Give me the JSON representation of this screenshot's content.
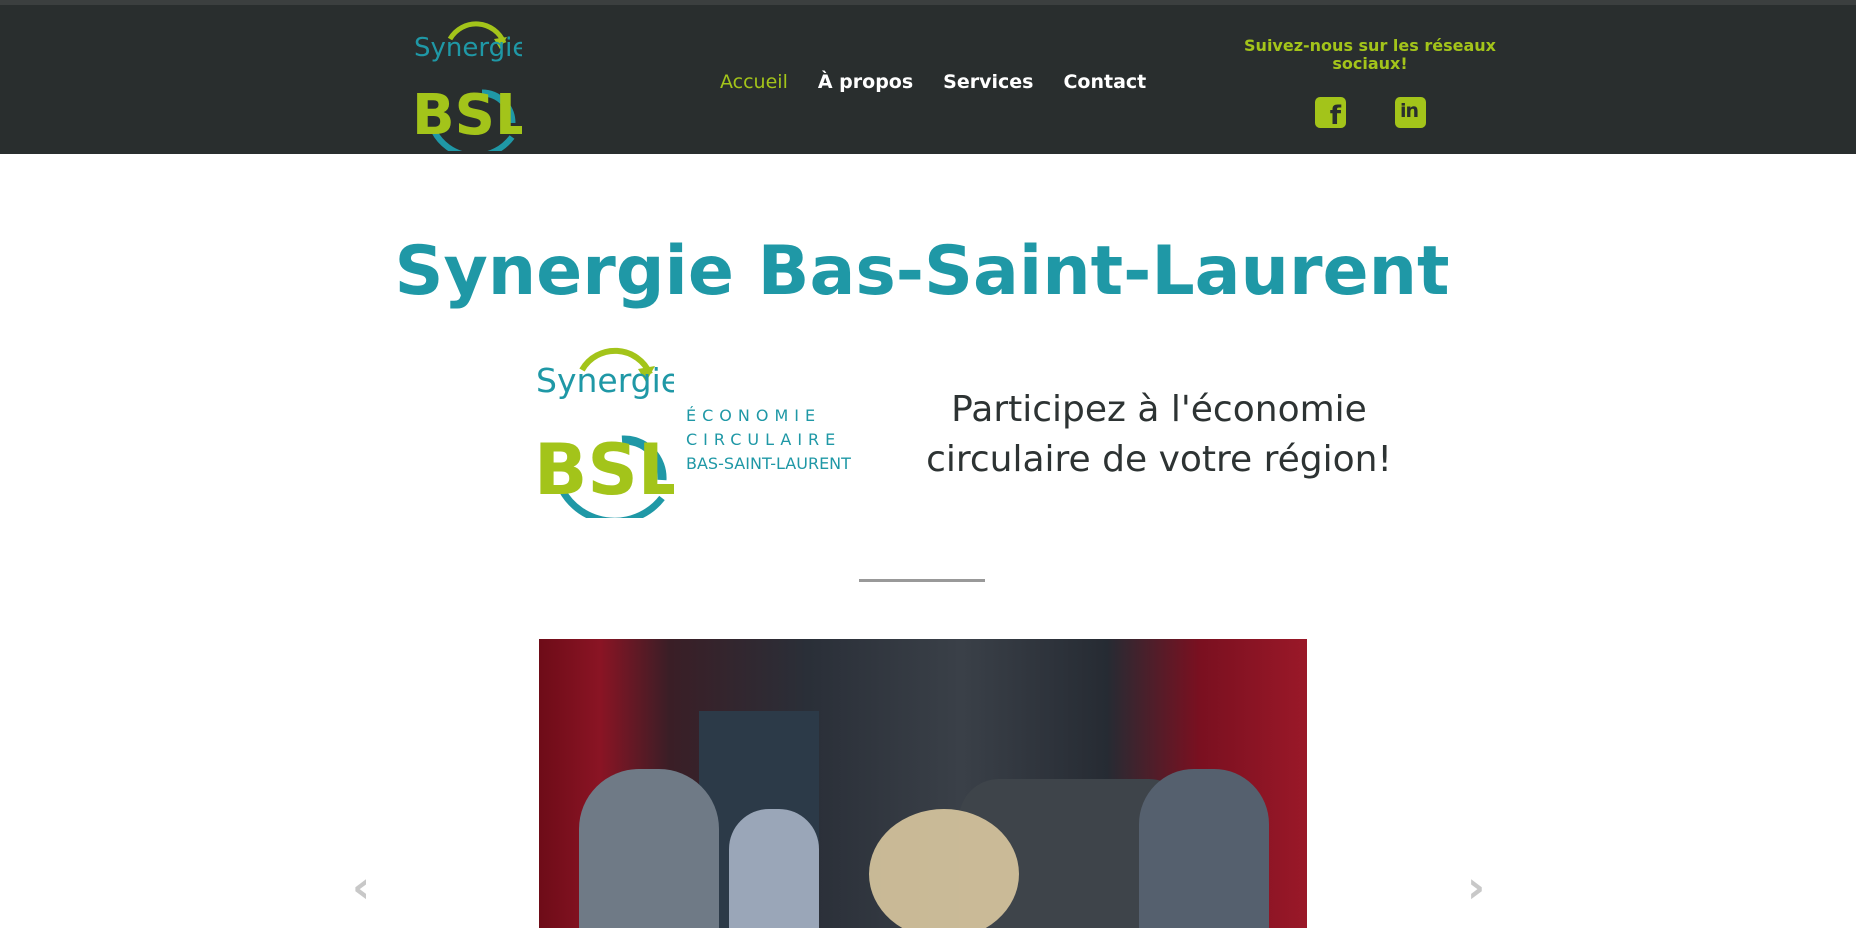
{
  "logo": {
    "name": "Synergie",
    "mark": "BSL"
  },
  "nav": {
    "items": [
      {
        "label": "Accueil"
      },
      {
        "label": "À propos"
      },
      {
        "label": "Services"
      },
      {
        "label": "Contact"
      }
    ]
  },
  "social": {
    "title": "Suivez-nous sur les réseaux sociaux!",
    "facebook_icon": "facebook-icon",
    "linkedin_icon": "linkedin-icon"
  },
  "hero": {
    "title": "Synergie Bas-Saint-Laurent",
    "logo_lines": [
      "ÉCONOMIE",
      "CIRCULAIRE",
      "BAS-SAINT-LAURENT"
    ],
    "tagline_line1": "Participez à l'économie",
    "tagline_line2": "circulaire de votre région!"
  },
  "carousel": {
    "prev_icon": "chevron-left-icon",
    "next_icon": "chevron-right-icon",
    "prev_glyph": "‹",
    "next_glyph": "›"
  },
  "colors": {
    "header_bg": "#292e2e",
    "accent_green": "#a3c41a",
    "brand_teal": "#1f98a6"
  }
}
